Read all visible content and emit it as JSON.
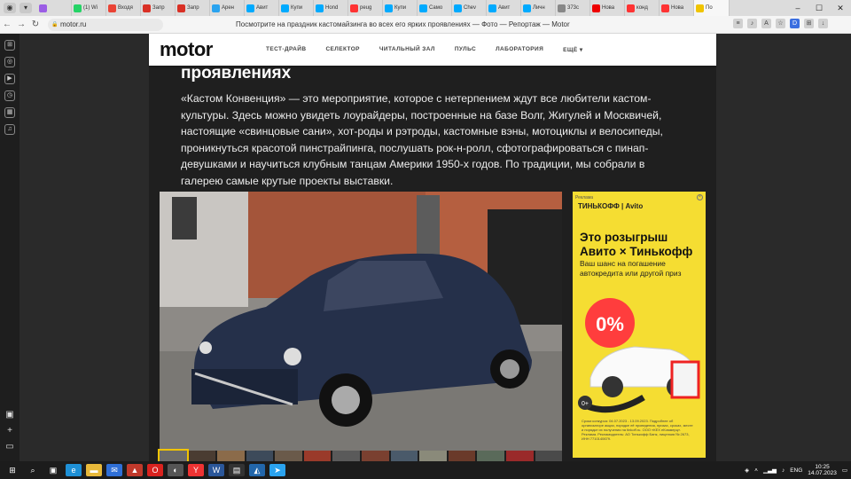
{
  "browser": {
    "tabs": [
      {
        "label": "",
        "color": "#9b5de5"
      },
      {
        "label": "(1) Wi",
        "color": "#25d366"
      },
      {
        "label": "Входя",
        "color": "#ea4335"
      },
      {
        "label": "Запр",
        "color": "#d93025"
      },
      {
        "label": "Запр",
        "color": "#d93025"
      },
      {
        "label": "Арен",
        "color": "#2aa3ef"
      },
      {
        "label": "Авит",
        "color": "#00aaff"
      },
      {
        "label": "Купи",
        "color": "#00aaff"
      },
      {
        "label": "Hond",
        "color": "#00aaff"
      },
      {
        "label": "peug",
        "color": "#f33"
      },
      {
        "label": "Купи",
        "color": "#00aaff"
      },
      {
        "label": "Само",
        "color": "#00aaff"
      },
      {
        "label": "Chev",
        "color": "#00aaff"
      },
      {
        "label": "Авит",
        "color": "#00aaff"
      },
      {
        "label": "Личн",
        "color": "#00aaff"
      },
      {
        "label": "373c",
        "color": "#888"
      },
      {
        "label": "Нова",
        "color": "#e00"
      },
      {
        "label": "конд",
        "color": "#f33"
      },
      {
        "label": "Нова",
        "color": "#f33"
      },
      {
        "label": "По",
        "color": "#f0c400"
      }
    ],
    "url": "motor.ru",
    "page_title": "Посмотрите на праздник кастомайзинга во всех его ярких проявлениях — Фото — Репортаж — Motor"
  },
  "site": {
    "logo": "motor",
    "nav": [
      "ТЕСТ-ДРАЙВ",
      "СЕЛЕКТОР",
      "ЧИТАЛЬНЫЙ ЗАЛ",
      "ПУЛЬС",
      "ЛАБОРАТОРИЯ",
      "ЕЩЁ ▾"
    ]
  },
  "article": {
    "heading": "проявлениях",
    "lead": "«Кастом Конвенция» — это мероприятие, которое с нетерпением ждут все любители кастом-культуры. Здесь можно увидеть лоурайдеры, построенные на базе Волг, Жигулей и Москвичей, настоящие «свинцовые сани», хот-роды и рэтроды, кастомные вэны, мотоциклы и велосипеды, проникнуться красотой пинстрайпинга, послушать рок-н-ролл, сфотографироваться с пинап-девушками и научиться клубным танцам Америки 1950-х годов. По традиции, мы собрали в галерею самые крутые проекты выставки."
  },
  "ad": {
    "label": "Реклама",
    "brand": "ТИНЬКОФФ | Avito",
    "title": "Это розыгрыш Авито × Тинькофф",
    "subtitle": "Ваш шанс на погашение автокредита или другой приз",
    "badge": "0%",
    "badge2": "0+",
    "fine": "Сроки конкурса: 04.07.2023 - 13.09.2023. Подробнее об организаторе акции, порядке её проведения, призах, сроках, месте и порядке их получения на tinkoff.ru. ООО «КЕХ еКоммерц». Реклама. Рекламодатель: АО Тинькофф Банк, лицензия № 2673, ИНН 7710140679."
  },
  "taskbar": {
    "lang": "ENG",
    "time": "10:25",
    "date": "14.07.2023"
  }
}
